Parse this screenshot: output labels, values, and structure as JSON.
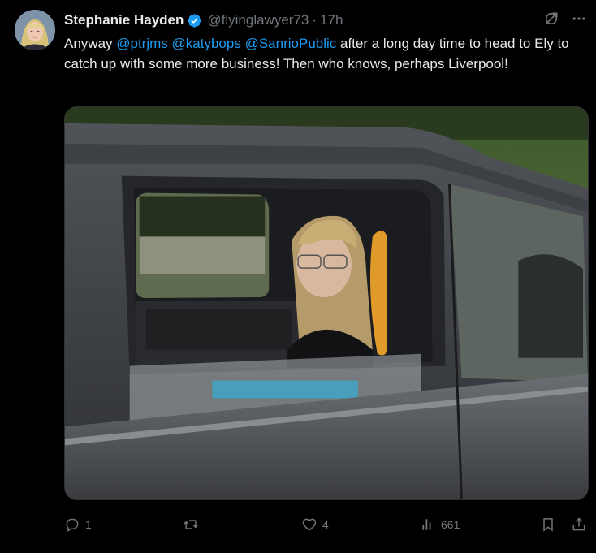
{
  "tweet": {
    "display_name": "Stephanie Hayden",
    "handle": "@flyinglawyer73",
    "separator": "·",
    "time": "17h",
    "text_prefix": "Anyway ",
    "mentions": [
      "@ptrjms",
      "@katybops",
      "@SanrioPublic"
    ],
    "text_suffix": " after a long day time to head to Ely to catch up with some more business! Then who knows, perhaps Liverpool!",
    "media_description_icon": "photo",
    "replies": "1",
    "reposts": "",
    "likes": "4",
    "views": "661"
  },
  "icons": {
    "verified": "verified-badge-icon",
    "grok": "grok-icon",
    "more": "more-icon",
    "reply": "reply-icon",
    "repost": "repost-icon",
    "like": "like-icon",
    "views": "views-icon",
    "bookmark": "bookmark-icon",
    "share": "share-icon"
  },
  "colors": {
    "background": "#000000",
    "text": "#e7e9ea",
    "secondary": "#71767b",
    "accent": "#1d9bf0"
  }
}
